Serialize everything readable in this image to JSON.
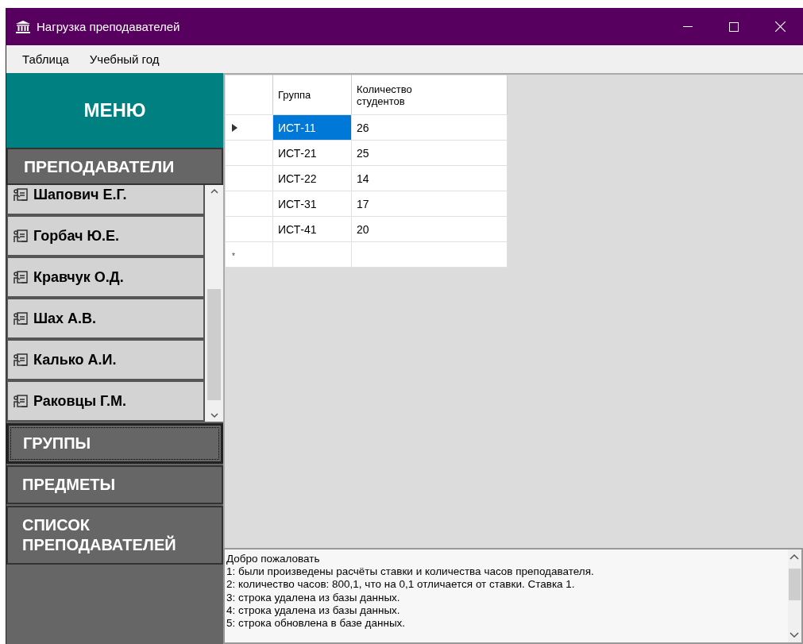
{
  "window": {
    "title": "Нагрузка преподавателей"
  },
  "menu": [
    "Таблица",
    "Учебный год"
  ],
  "sidebar": {
    "header": "МЕНЮ",
    "section": "ПРЕПОДАВАТЕЛИ",
    "teachers": [
      "Шапович Е.Г.",
      "Горбач Ю.Е.",
      "Кравчук О.Д.",
      "Шах А.В.",
      "Калько А.И.",
      "Раковцы Г.М."
    ],
    "nav": [
      {
        "label": "ГРУППЫ",
        "selected": true
      },
      {
        "label": "ПРЕДМЕТЫ",
        "selected": false
      },
      {
        "label": "СПИСОК ПРЕПОДАВАТЕЛЕЙ",
        "selected": false
      }
    ]
  },
  "table": {
    "columns": [
      "Группа",
      "Количество студентов"
    ],
    "rows": [
      {
        "cells": [
          "ИСТ-11",
          "26"
        ],
        "selected": true
      },
      {
        "cells": [
          "ИСТ-21",
          "25"
        ],
        "selected": false
      },
      {
        "cells": [
          "ИСТ-22",
          "14"
        ],
        "selected": false
      },
      {
        "cells": [
          "ИСТ-31",
          "17"
        ],
        "selected": false
      },
      {
        "cells": [
          "ИСТ-41",
          "20"
        ],
        "selected": false
      }
    ],
    "new_row_marker": "*"
  },
  "log": [
    "Добро пожаловать",
    "1: были произведены расчёты ставки и количества часов преподавателя.",
    "2: количество часов: 800,1, что на 0,1 отличается от ставки. Ставка 1.",
    "3: строка удалена из базы данных.",
    "4: строка удалена из базы данных.",
    "5: строка обновлена в базе данных."
  ]
}
